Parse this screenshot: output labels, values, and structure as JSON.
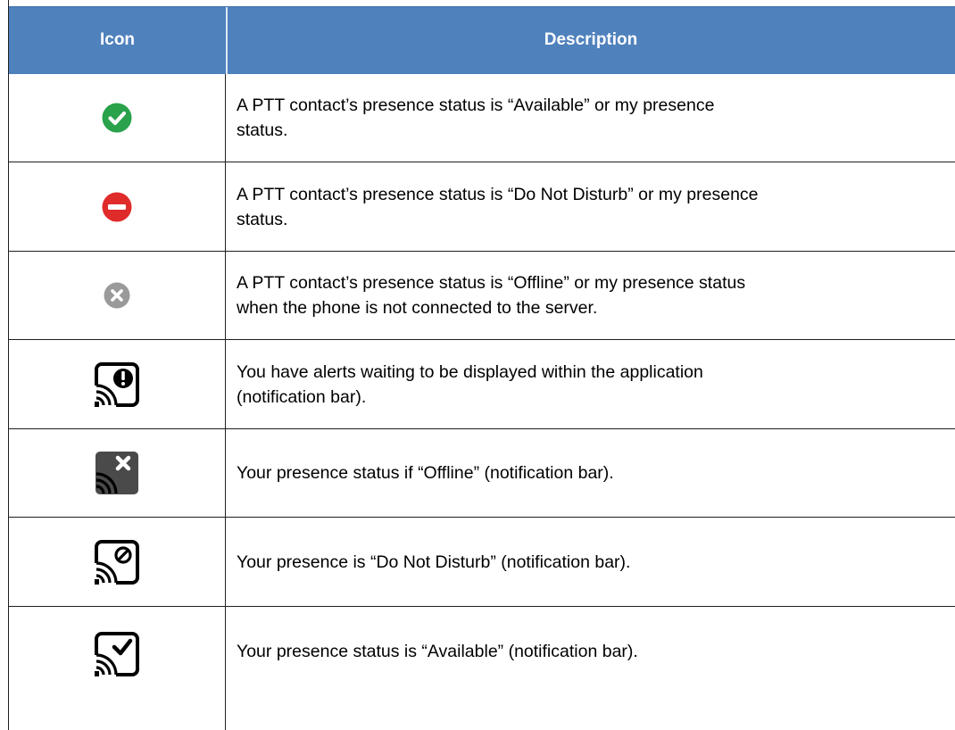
{
  "header": {
    "icon_label": "Icon",
    "description_label": "Description",
    "background": "#4f81bd"
  },
  "rows": [
    {
      "icon": "check-circle-green-icon",
      "description": "A PTT contact’s presence status is “Available” or my presence\nstatus."
    },
    {
      "icon": "do-not-disturb-red-icon",
      "description": "A PTT contact’s presence status is “Do Not Disturb” or my presence\nstatus."
    },
    {
      "icon": "offline-gray-x-icon",
      "description": "A PTT contact’s presence status is “Offline” or my presence status\nwhen the phone is not connected to the server."
    },
    {
      "icon": "notification-alert-icon",
      "description": "You have alerts waiting to be displayed within the application\n(notification bar)."
    },
    {
      "icon": "notification-offline-icon",
      "description": "Your presence status if “Offline” (notification bar)."
    },
    {
      "icon": "notification-dnd-icon",
      "description": "Your presence is “Do Not Disturb” (notification bar)."
    },
    {
      "icon": "notification-available-icon",
      "description": "Your presence status is “Available” (notification bar)."
    }
  ],
  "colors": {
    "available": "#2aa14b",
    "do_not_disturb": "#e02b2b",
    "offline": "#9a9a9a"
  }
}
